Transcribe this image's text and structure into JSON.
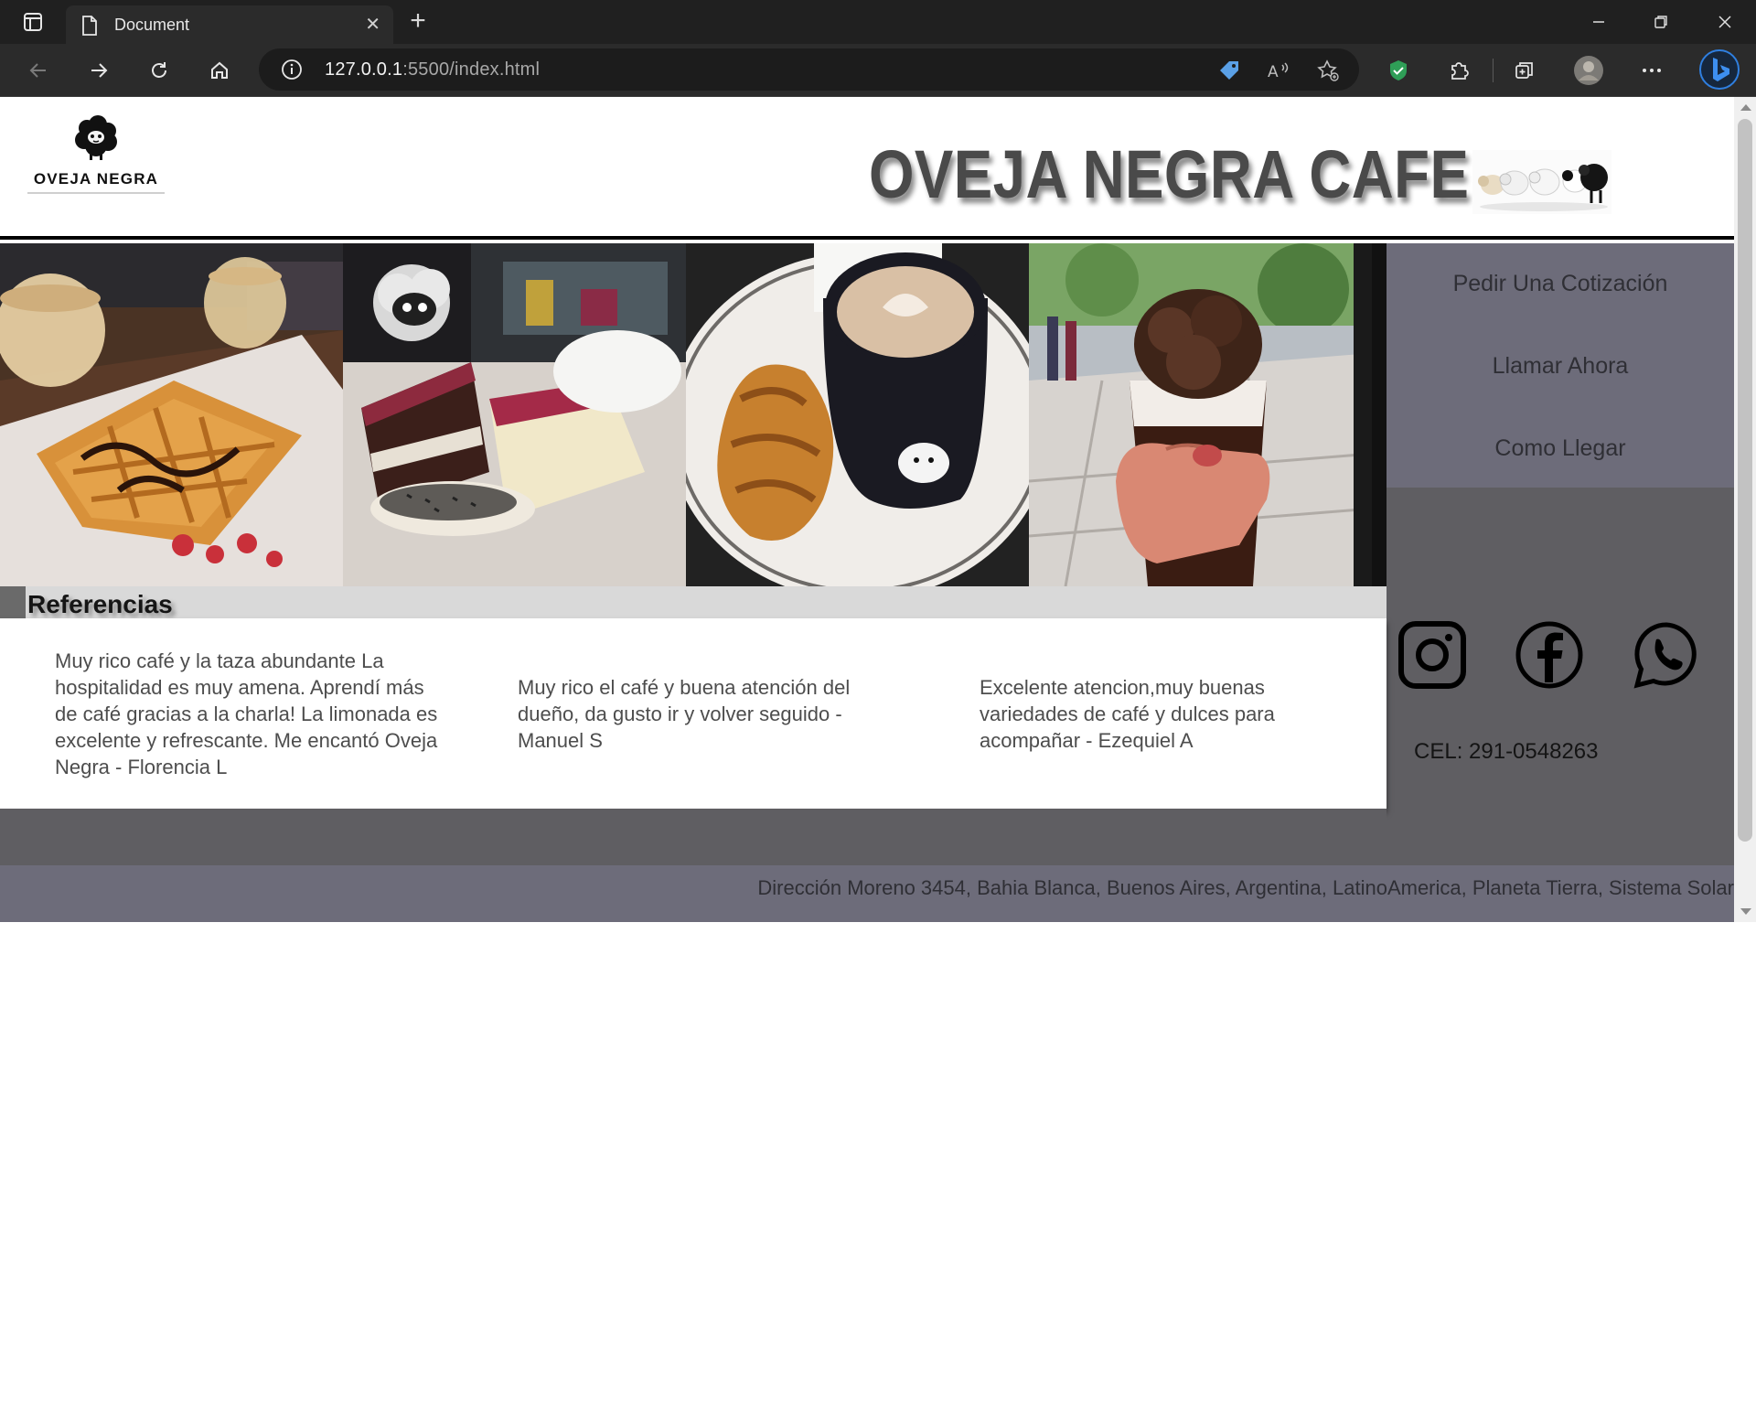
{
  "browser": {
    "tab_title": "Document",
    "url_host": "127.0.0.1",
    "url_rest": ":5500/index.html"
  },
  "header": {
    "logo_text": "OVEJA NEGRA",
    "title": "OVEJA NEGRA CAFE"
  },
  "nav": {
    "items": [
      "Pedir Una Cotización",
      "Llamar Ahora",
      "Como Llegar"
    ]
  },
  "contact": {
    "phone": "CEL: 291-0548263"
  },
  "references": {
    "title": "Referencias",
    "reviews": [
      "Muy rico café y la taza abundante La hospitalidad es muy amena. Aprendí más de café gracias a la charla! La limonada es excelente y refrescante. Me encantó Oveja Negra - Florencia L",
      "Muy rico el café y buena atención del dueño, da gusto ir y volver seguido - Manuel S",
      "Excelente atencion,muy buenas variedades de café y dulces para acompañar - Ezequiel A"
    ]
  },
  "footer": {
    "address": "Dirección Moreno 3454, Bahia Blanca, Buenos Aires, Argentina, LatinoAmerica, Planeta Tierra, Sistema Solar"
  },
  "icons": [
    "sidebar-icon",
    "page-icon",
    "close-icon",
    "plus-icon",
    "minimize-icon",
    "restore-icon",
    "close-window-icon",
    "back-icon",
    "forward-icon",
    "refresh-icon",
    "home-icon",
    "info-icon",
    "coupon-icon",
    "read-aloud-icon",
    "favorite-icon",
    "shield-icon",
    "extensions-icon",
    "collections-icon",
    "profile-avatar",
    "more-icon",
    "bing-icon",
    "instagram-icon",
    "facebook-icon",
    "whatsapp-icon"
  ],
  "colors": {
    "nav_bg": "#6d6c7a",
    "contact_bg": "#5f5e62",
    "refs_bar": "#d9d9d9",
    "title_text": "#4a4a4a"
  }
}
